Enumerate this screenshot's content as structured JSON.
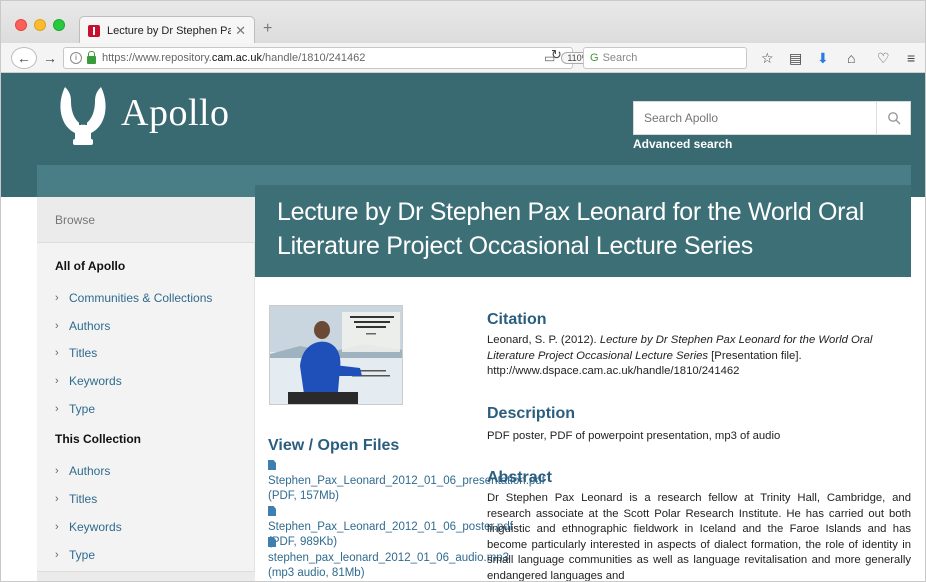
{
  "browser": {
    "tab_title": "Lecture by Dr Stephen Pax Le",
    "url_scheme": "https://www.repository.",
    "url_host": "cam.ac.uk",
    "url_path": "/handle/1810/241462",
    "zoom": "110%",
    "search_placeholder": "Search"
  },
  "site": {
    "brand": "Apollo",
    "search_placeholder": "Search Apollo",
    "advanced_search": "Advanced search"
  },
  "page": {
    "title": "Lecture by Dr Stephen Pax Leonard for the World Oral Literature Project Occasional Lecture Series"
  },
  "sidebar": {
    "browse": "Browse",
    "all_of_apollo": "All of Apollo",
    "apollo_items": [
      {
        "label": "Communities & Collections"
      },
      {
        "label": "Authors"
      },
      {
        "label": "Titles"
      },
      {
        "label": "Keywords"
      },
      {
        "label": "Type"
      }
    ],
    "this_collection": "This Collection",
    "collection_items": [
      {
        "label": "Authors"
      },
      {
        "label": "Titles"
      },
      {
        "label": "Keywords"
      },
      {
        "label": "Type"
      }
    ]
  },
  "files": {
    "heading": "View / Open Files",
    "items": [
      {
        "text": "Stephen_Pax_Leonard_2012_01_06_presentation.pdf (PDF, 157Mb)"
      },
      {
        "text": "Stephen_Pax_Leonard_2012_01_06_poster.pdf (PDF, 989Kb)"
      },
      {
        "text": "stephen_pax_leonard_2012_01_06_audio.mp3 (mp3 audio, 81Mb)"
      }
    ]
  },
  "citation": {
    "heading": "Citation",
    "prefix": "Leonard, S. P. (2012). ",
    "title_italic": "Lecture by Dr Stephen Pax Leonard for the World Oral Literature Project Occasional Lecture Series",
    "suffix": " [Presentation file]. http://www.dspace.cam.ac.uk/handle/1810/241462"
  },
  "description": {
    "heading": "Description",
    "text": "PDF poster, PDF of powerpoint presentation, mp3 of audio"
  },
  "abstract": {
    "heading": "Abstract",
    "text": "Dr Stephen Pax Leonard is a research fellow at Trinity Hall, Cambridge, and research associate at the Scott Polar Research Institute. He has carried out both linguistic and ethnographic fieldwork in Iceland and the Faroe Islands and has become particularly interested in aspects of dialect formation, the role of identity in small language communities as well as language revitalisation and more generally endangered languages and"
  },
  "colors": {
    "header": "#396a72",
    "title_box": "#3d6f77",
    "link": "#2f6b8f",
    "heading": "#2b5e7e"
  }
}
